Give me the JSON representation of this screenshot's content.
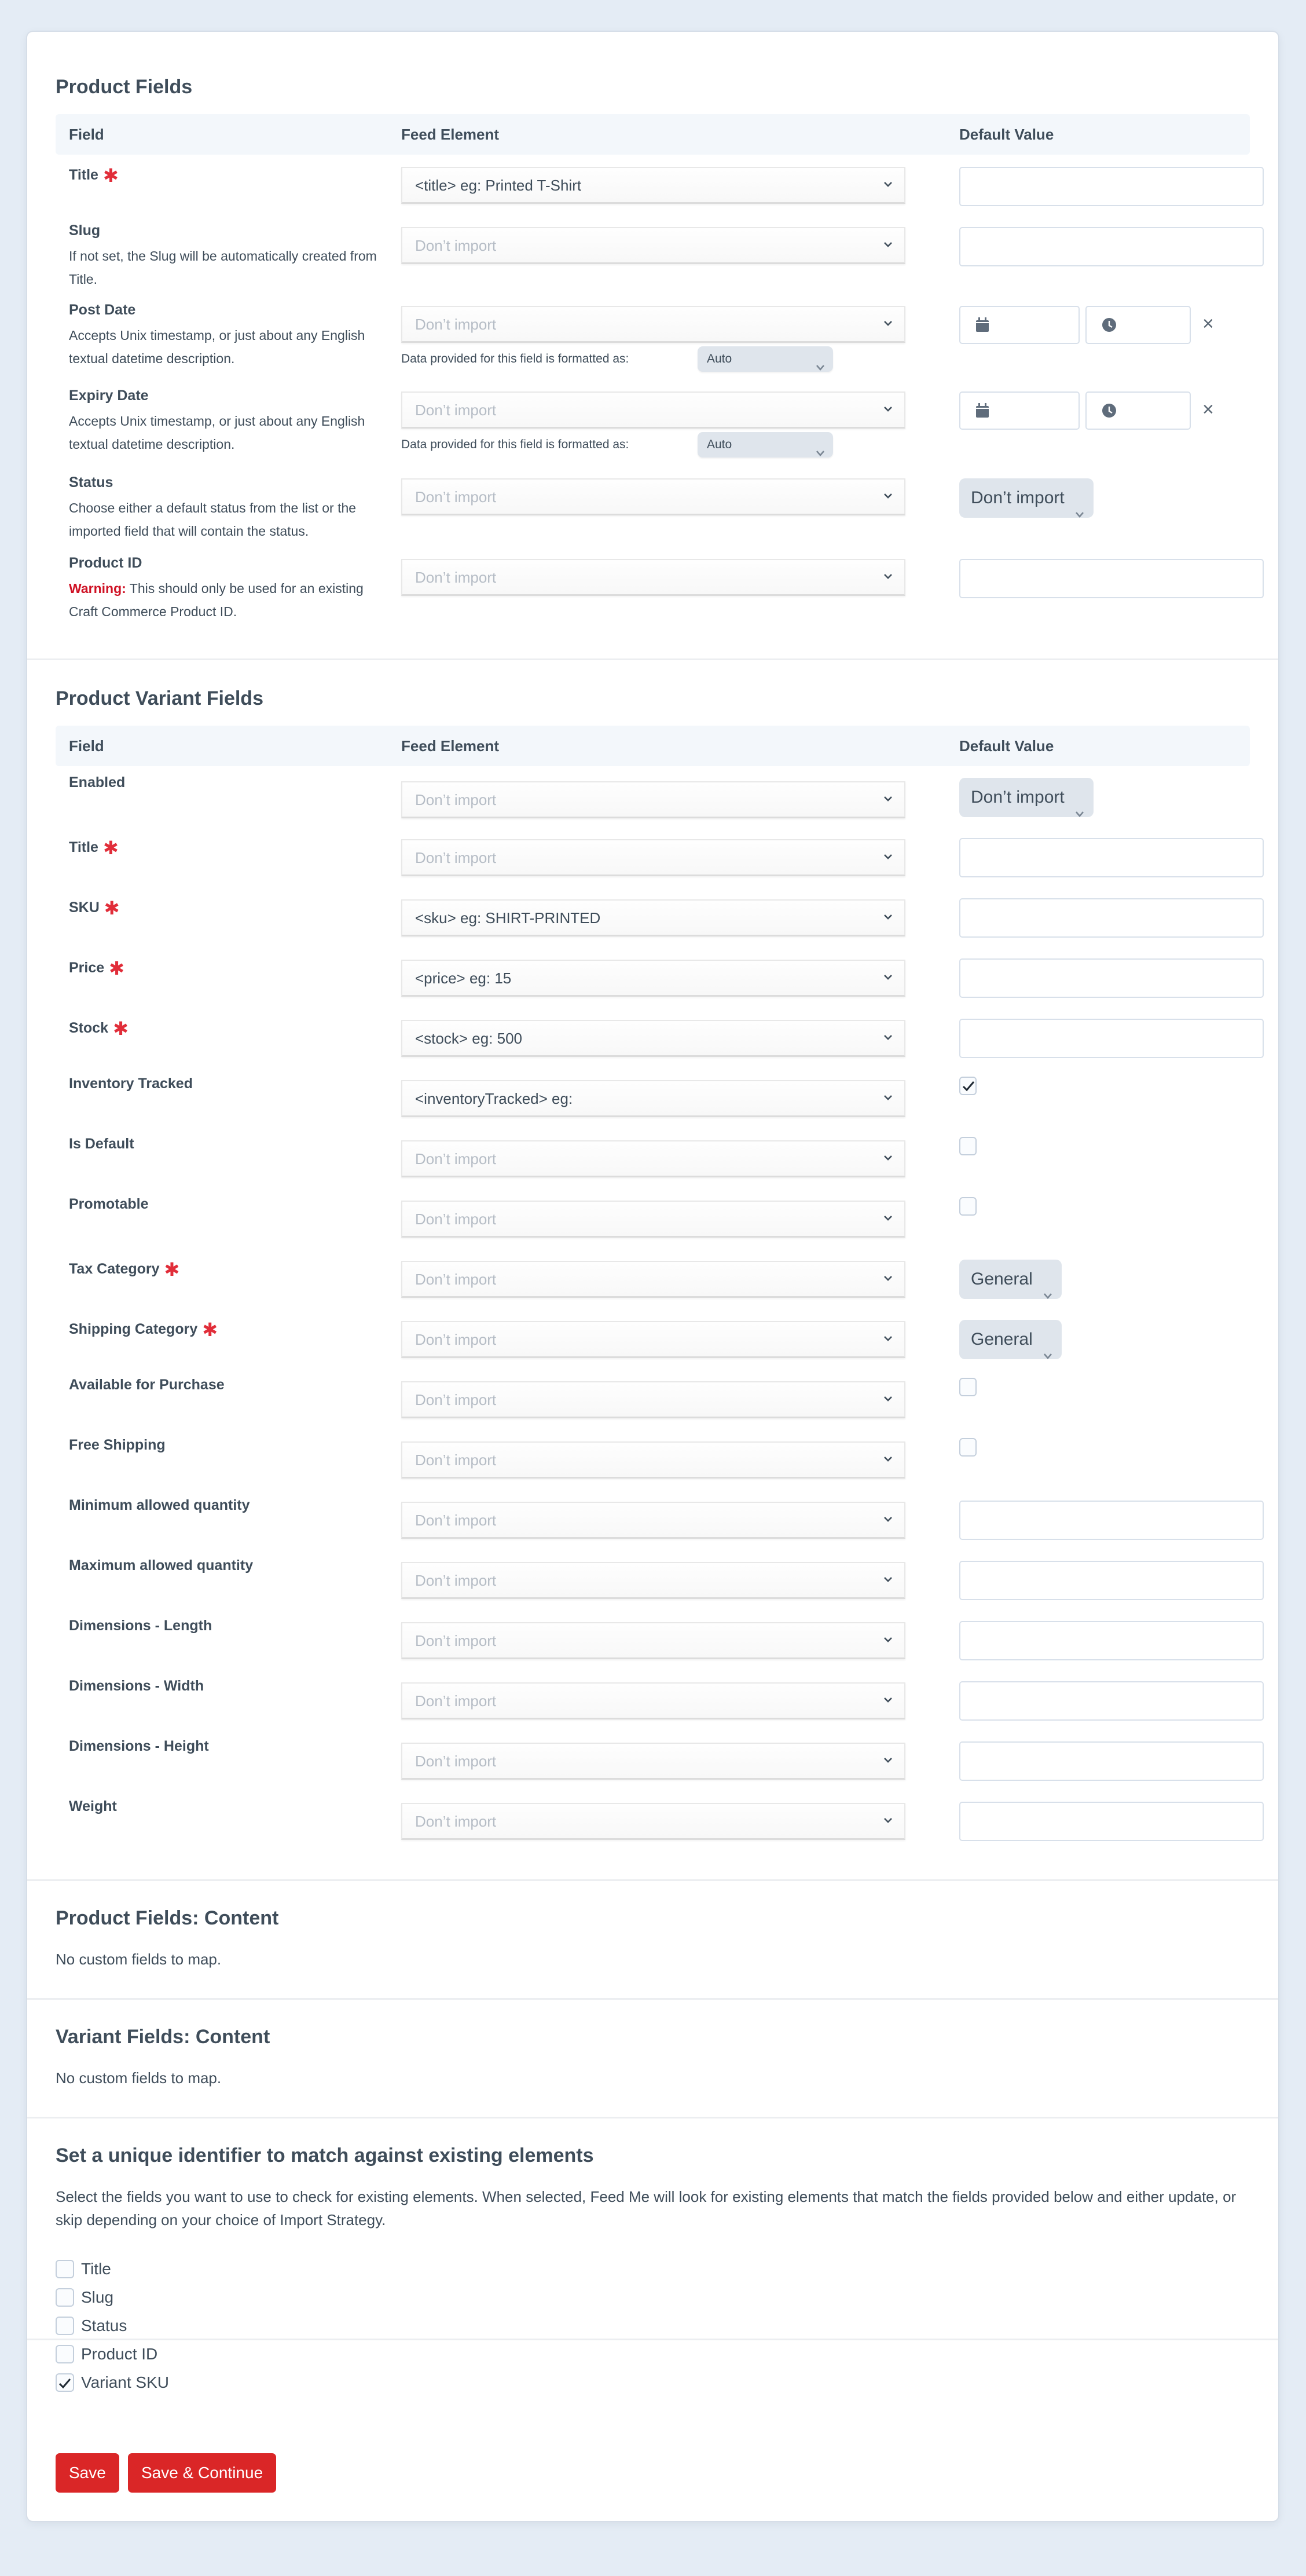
{
  "colors": {
    "background": "#e4ecf5",
    "card": "#ffffff",
    "text": "#3f4d5a",
    "required": "#e12d39",
    "warning": "#cf1124",
    "primary_button": "#da2627",
    "pill": "#dfe5ec",
    "table_header": "#f3f7fb"
  },
  "columns": {
    "field": "Field",
    "feed_element": "Feed Element",
    "default_value": "Default Value"
  },
  "product_fields": {
    "heading": "Product Fields",
    "format_label": "Data provided for this field is formatted as:",
    "rows": [
      {
        "label": "Title",
        "required": true,
        "instructions": "",
        "feed_value": "<title> eg: Printed T-Shirt",
        "placeholder": false,
        "default_type": "text",
        "default_value": ""
      },
      {
        "label": "Slug",
        "required": false,
        "instructions": "If not set, the Slug will be automatically created from Title.",
        "feed_value": "Don’t import",
        "placeholder": true,
        "default_type": "text",
        "default_value": ""
      },
      {
        "label": "Post Date",
        "required": false,
        "instructions": "Accepts Unix timestamp, or just about any English textual datetime description.",
        "feed_value": "Don’t import",
        "placeholder": true,
        "default_type": "datetime",
        "format_value": "Auto",
        "date_icon": "calendar-icon",
        "time_icon": "clock-icon",
        "clear_icon": "×"
      },
      {
        "label": "Expiry Date",
        "required": false,
        "instructions": "Accepts Unix timestamp, or just about any English textual datetime description.",
        "feed_value": "Don’t import",
        "placeholder": true,
        "default_type": "datetime",
        "format_value": "Auto",
        "date_icon": "calendar-icon",
        "time_icon": "clock-icon",
        "clear_icon": "×"
      },
      {
        "label": "Status",
        "required": false,
        "instructions": "Choose either a default status from the list or the imported field that will contain the status.",
        "feed_value": "Don’t import",
        "placeholder": true,
        "default_type": "select",
        "default_value": "Don’t import"
      },
      {
        "label": "Product ID",
        "required": false,
        "warning_label": "Warning:",
        "instructions": "This should only be used for an existing Craft Commerce Product ID.",
        "feed_value": "Don’t import",
        "placeholder": true,
        "default_type": "text",
        "default_value": ""
      }
    ]
  },
  "variant_fields": {
    "heading": "Product Variant Fields",
    "rows": [
      {
        "label": "Enabled",
        "required": false,
        "feed_value": "Don’t import",
        "placeholder": true,
        "default_type": "select",
        "default_value": "Don’t import"
      },
      {
        "label": "Title",
        "required": true,
        "feed_value": "Don’t import",
        "placeholder": true,
        "default_type": "text",
        "default_value": ""
      },
      {
        "label": "SKU",
        "required": true,
        "feed_value": "<sku> eg: SHIRT-PRINTED",
        "placeholder": false,
        "default_type": "text",
        "default_value": ""
      },
      {
        "label": "Price",
        "required": true,
        "feed_value": "<price> eg: 15",
        "placeholder": false,
        "default_type": "text",
        "default_value": ""
      },
      {
        "label": "Stock",
        "required": true,
        "feed_value": "<stock> eg: 500",
        "placeholder": false,
        "default_type": "text",
        "default_value": ""
      },
      {
        "label": "Inventory Tracked",
        "required": false,
        "feed_value": "<inventoryTracked> eg:",
        "placeholder": false,
        "default_type": "checkbox",
        "checked": true
      },
      {
        "label": "Is Default",
        "required": false,
        "feed_value": "Don’t import",
        "placeholder": true,
        "default_type": "checkbox",
        "checked": false
      },
      {
        "label": "Promotable",
        "required": false,
        "feed_value": "Don’t import",
        "placeholder": true,
        "default_type": "checkbox",
        "checked": false
      },
      {
        "label": "Tax Category",
        "required": true,
        "feed_value": "Don’t import",
        "placeholder": true,
        "default_type": "select",
        "default_value": "General"
      },
      {
        "label": "Shipping Category",
        "required": true,
        "feed_value": "Don’t import",
        "placeholder": true,
        "default_type": "select",
        "default_value": "General"
      },
      {
        "label": "Available for Purchase",
        "required": false,
        "feed_value": "Don’t import",
        "placeholder": true,
        "default_type": "checkbox",
        "checked": false
      },
      {
        "label": "Free Shipping",
        "required": false,
        "feed_value": "Don’t import",
        "placeholder": true,
        "default_type": "checkbox",
        "checked": false
      },
      {
        "label": "Minimum allowed quantity",
        "required": false,
        "feed_value": "Don’t import",
        "placeholder": true,
        "default_type": "text",
        "default_value": ""
      },
      {
        "label": "Maximum allowed quantity",
        "required": false,
        "feed_value": "Don’t import",
        "placeholder": true,
        "default_type": "text",
        "default_value": ""
      },
      {
        "label": "Dimensions - Length",
        "required": false,
        "feed_value": "Don’t import",
        "placeholder": true,
        "default_type": "text",
        "default_value": ""
      },
      {
        "label": "Dimensions - Width",
        "required": false,
        "feed_value": "Don’t import",
        "placeholder": true,
        "default_type": "text",
        "default_value": ""
      },
      {
        "label": "Dimensions - Height",
        "required": false,
        "feed_value": "Don’t import",
        "placeholder": true,
        "default_type": "text",
        "default_value": ""
      },
      {
        "label": "Weight",
        "required": false,
        "feed_value": "Don’t import",
        "placeholder": true,
        "default_type": "text",
        "default_value": ""
      }
    ]
  },
  "product_content": {
    "heading": "Product Fields: Content",
    "message": "No custom fields to map."
  },
  "variant_content": {
    "heading": "Variant Fields: Content",
    "message": "No custom fields to map."
  },
  "unique_identifier": {
    "heading": "Set a unique identifier to match against existing elements",
    "description": "Select the fields you want to use to check for existing elements. When selected, Feed Me will look for existing elements that match the fields provided below and either update, or skip depending on your choice of Import Strategy.",
    "options": [
      {
        "label": "Title",
        "checked": false
      },
      {
        "label": "Slug",
        "checked": false
      },
      {
        "label": "Status",
        "checked": false
      },
      {
        "label": "Product ID",
        "checked": false
      },
      {
        "label": "Variant SKU",
        "checked": true
      }
    ]
  },
  "actions": {
    "save": "Save",
    "save_continue": "Save & Continue"
  }
}
